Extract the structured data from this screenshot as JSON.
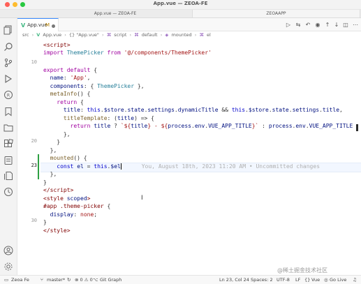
{
  "window": {
    "title": "App.vue — ZEOA-FE",
    "browser_tabs": [
      "App.vue — ZEOA-FE",
      "ZEOAAPP"
    ]
  },
  "editor_tab": {
    "icon": "V",
    "filename": "App.vue",
    "status": "M"
  },
  "breadcrumb": [
    "src",
    "App.vue",
    "{} \"App.vue\"",
    "script",
    "default",
    "mounted",
    "el"
  ],
  "gutter_numbers": {
    "l10": "10",
    "l20": "20",
    "l23": "23",
    "l30": "30"
  },
  "code": {
    "blame": "You, August 18th, 2023 11:20 AM • Uncommitted changes"
  },
  "statusbar": {
    "remote": "Zeoa Fe",
    "branch": "master*",
    "problems": "⊗ 0 ⚠ 0",
    "git_graph": "Git Graph",
    "cursor": "Ln 23, Col 24",
    "spaces": "Spaces: 2",
    "encoding": "UTF-8",
    "eol": "LF",
    "language": "Vue",
    "golive": "Go Live"
  },
  "watermark": "@稀土掘金技术社区",
  "colors": {
    "accent": "#3c8cff",
    "vue": "#42b883",
    "git_modified": "#2ea043"
  }
}
